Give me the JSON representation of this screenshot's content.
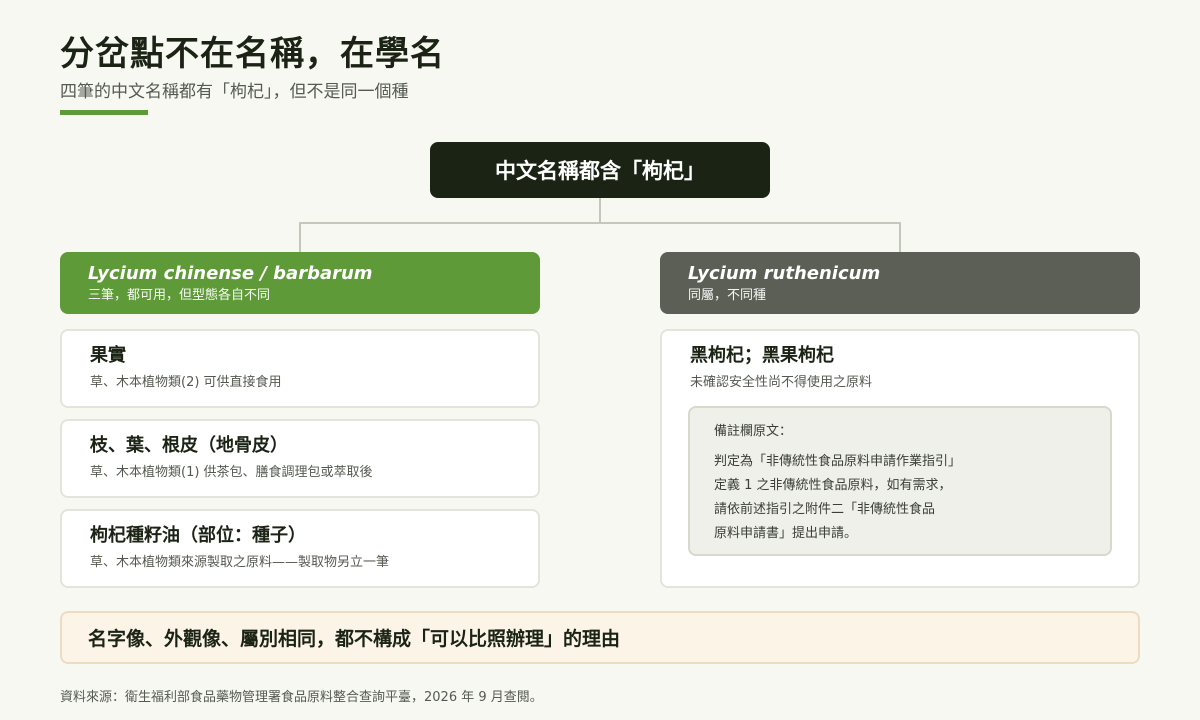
{
  "header": {
    "title": "分岔點不在名稱，在學名",
    "subtitle": "四筆的中文名稱都有「枸杞」，但不是同一個種"
  },
  "root": {
    "label": "中文名稱都含「枸杞」"
  },
  "left": {
    "scientific_name": "Lycium chinense / barbarum",
    "note": "三筆，都可用，但型態各自不同",
    "cards": [
      {
        "title": "果實",
        "desc": "草、木本植物類(2) 可供直接食用"
      },
      {
        "title": "枝、葉、根皮（地骨皮）",
        "desc": "草、木本植物類(1) 供茶包、膳食調理包或萃取後"
      },
      {
        "title": "枸杞種籽油（部位：種子）",
        "desc": "草、木本植物類來源製取之原料——製取物另立一筆"
      }
    ]
  },
  "right": {
    "scientific_name": "Lycium ruthenicum",
    "note": "同屬，不同種",
    "card": {
      "title": "黑枸杞；黑果枸杞",
      "desc": "未確認安全性尚不得使用之原料",
      "remark_heading": "備註欄原文：",
      "remark_lines": [
        "判定為「非傳統性食品原料申請作業指引」",
        "定義 1 之非傳統性食品原料，如有需求，",
        "請依前述指引之附件二「非傳統性食品",
        "原料申請書」提出申請。"
      ]
    }
  },
  "banner": {
    "text": "名字像、外觀像、屬別相同，都不構成「可以比照辦理」的理由"
  },
  "footer": {
    "source": "資料來源：衛生福利部食品藥物管理署食品原料整合查詢平臺，2026 年 9 月查閱。"
  },
  "colors": {
    "accent_green": "#5f9a38",
    "dark": "#1b2315",
    "gray_header": "#5b5f55",
    "banner_bg": "#fcf4e7"
  }
}
